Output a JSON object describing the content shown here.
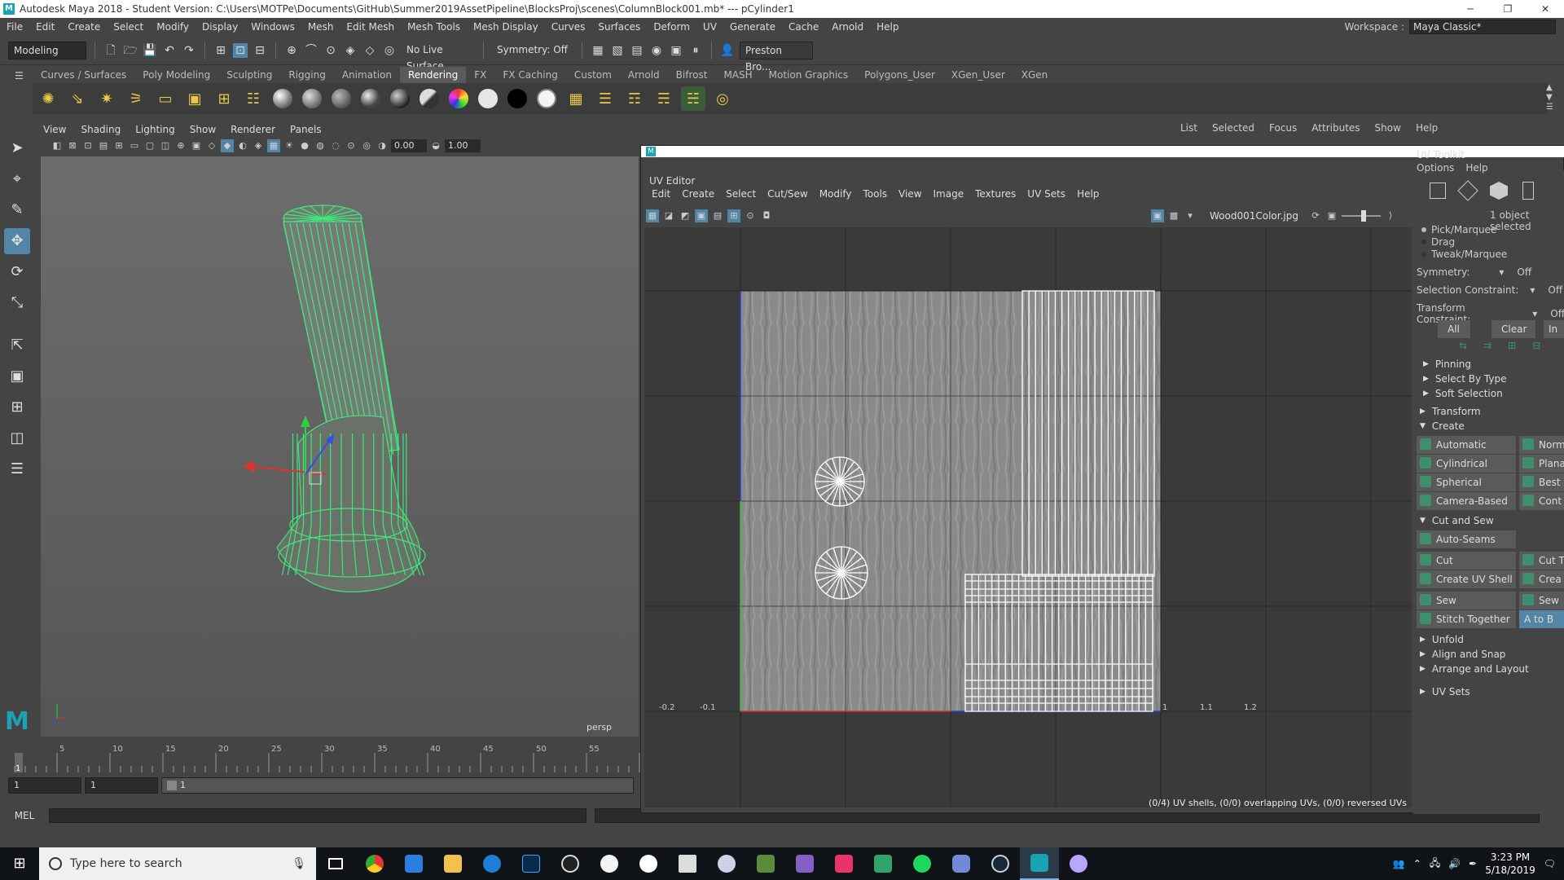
{
  "titlebar": {
    "title": "Autodesk Maya 2018 - Student Version: C:\\Users\\MOTPe\\Documents\\GitHub\\Summer2019AssetPipeline\\BlocksProj\\scenes\\ColumnBlock001.mb*  ---  pCylinder1"
  },
  "menubar": {
    "items": [
      "File",
      "Edit",
      "Create",
      "Select",
      "Modify",
      "Display",
      "Windows",
      "Mesh",
      "Edit Mesh",
      "Mesh Tools",
      "Mesh Display",
      "Curves",
      "Surfaces",
      "Deform",
      "UV",
      "Generate",
      "Cache",
      "Arnold",
      "Help"
    ]
  },
  "workspace": {
    "label": "Workspace :",
    "value": "Maya Classic*"
  },
  "statusline": {
    "mode": "Modeling",
    "live_surface": "No Live Surface",
    "symmetry": "Symmetry: Off",
    "user": "Preston Bro..."
  },
  "shelf_tabs": [
    "Curves / Surfaces",
    "Poly Modeling",
    "Sculpting",
    "Rigging",
    "Animation",
    "Rendering",
    "FX",
    "FX Caching",
    "Custom",
    "Arnold",
    "Bifrost",
    "MASH",
    "Motion Graphics",
    "Polygons_User",
    "XGen_User",
    "XGen"
  ],
  "shelf_active": "Rendering",
  "viewport": {
    "menus": [
      "View",
      "Shading",
      "Lighting",
      "Show",
      "Renderer",
      "Panels"
    ],
    "field1": "0.00",
    "field2": "1.00",
    "label": "persp"
  },
  "attr_editor_menu": [
    "List",
    "Selected",
    "Focus",
    "Attributes",
    "Show",
    "Help"
  ],
  "timeline": {
    "ticks": [
      "5",
      "10",
      "15",
      "20",
      "25",
      "30",
      "35",
      "40",
      "45",
      "50",
      "55"
    ],
    "current": "1"
  },
  "range": {
    "start": "1",
    "start2": "1",
    "frame": "1"
  },
  "cmdline": {
    "label": "MEL"
  },
  "uv_editor": {
    "title": "UV Editor",
    "menus": [
      "Edit",
      "Create",
      "Select",
      "Cut/Sew",
      "Modify",
      "Tools",
      "View",
      "Image",
      "Textures",
      "UV Sets",
      "Help"
    ],
    "texture": "Wood001Color.jpg",
    "axis_labels": [
      "-0.2",
      "-0.1",
      "1",
      "1.1",
      "1.2"
    ],
    "status": "(0/4) UV shells, (0/0) overlapping UVs, (0/0) reversed UVs"
  },
  "toolkit": {
    "title": "UV Toolkit",
    "menus": [
      "Options",
      "Help"
    ],
    "selected": "1 object selected",
    "modes": [
      "Pick/Marquee",
      "Drag",
      "Tweak/Marquee"
    ],
    "symmetry_label": "Symmetry:",
    "symmetry_value": "Off",
    "selection_constraint": "Selection Constraint:",
    "sel_value": "Off",
    "transform_constraint": "Transform Constraint:",
    "tr_value": "Off",
    "btn_all": "All",
    "btn_clear": "Clear",
    "btn_in": "In",
    "subsections": [
      "Pinning",
      "Select By Type",
      "Soft Selection"
    ],
    "sections": [
      "Transform",
      "Create",
      "Cut and Sew",
      "Unfold",
      "Align and Snap",
      "Arrange and Layout",
      "UV Sets"
    ],
    "create_left": [
      "Automatic",
      "Cylindrical",
      "Spherical",
      "Camera-Based"
    ],
    "create_right": [
      "Norm",
      "Plana",
      "Best",
      "Cont"
    ],
    "auto_seams": "Auto-Seams",
    "cut": "Cut",
    "cut_r": "Cut T",
    "create_shell": "Create UV Shell",
    "create_r": "Crea",
    "sew": "Sew",
    "sew_r": "Sew",
    "stitch": "Stitch Together",
    "stitch_r": "A to B"
  },
  "taskbar": {
    "search_placeholder": "Type here to search",
    "time": "3:23 PM",
    "date": "5/18/2019"
  },
  "colors": {
    "accent": "#5285a6",
    "wireframe": "#3fe87a",
    "uvwire": "#ffffff"
  }
}
